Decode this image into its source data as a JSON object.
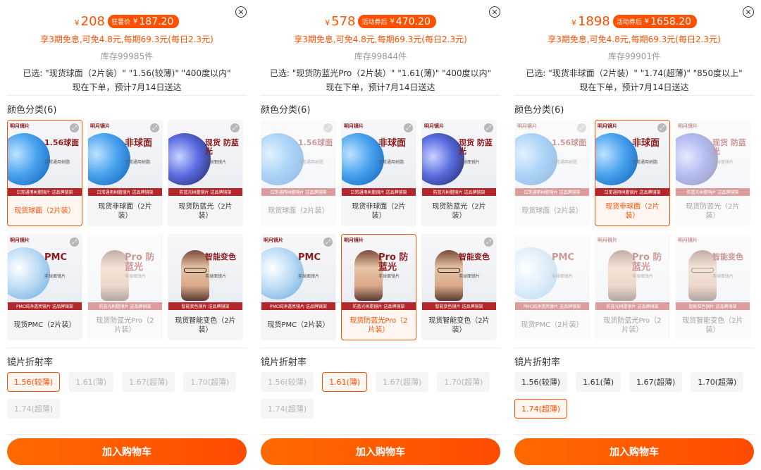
{
  "colors": {
    "accent": "#ff5000",
    "band": "#b3282d"
  },
  "icons": {
    "close": "close-icon",
    "zoom": "expand-icon"
  },
  "lens_options": [
    {
      "thumb_name": "1.56球面",
      "thumb_sub": "日常通用树脂",
      "band": "日常通用树脂镜片 送品牌镜架",
      "style": "blue"
    },
    {
      "thumb_name": "非球面",
      "thumb_sub": "日常通用树脂",
      "band": "日常通用树脂镜片 送品牌镜架",
      "style": "blue"
    },
    {
      "thumb_name": "现货 防蓝光",
      "thumb_sub": "非球面镜片",
      "band": "防蓝光树脂镜片 送品牌镜架",
      "style": "dark"
    },
    {
      "thumb_name": "PMC",
      "thumb_sub": "非球面镜片",
      "band": "PMC纯净透亮镜片 送品牌镜架",
      "style": "light"
    },
    {
      "thumb_name": "Pro 防蓝光",
      "thumb_sub": "非球面镜片",
      "band": "防蓝光树脂镜片 送品牌镜架",
      "style": "face"
    },
    {
      "thumb_name": "智能变色",
      "thumb_sub": "非球面镜片",
      "band": "智能变色镜片 送品牌镜架",
      "style": "face"
    }
  ],
  "panels": [
    {
      "price": "208",
      "promo_tag": "狂暑价",
      "promo_price": "187.20",
      "installment": "享3期免息,可免4.8元,每期69.3元(每日2.3元)",
      "stock": "库存99985件",
      "selected": "已选: \"现货球面（2片装）\" \"1.56(较薄)\" \"400度以内\"",
      "delivery": "现在下单，预计7月14日送达",
      "color_title": "颜色分类(6)",
      "color_options": [
        "现货球面（2片装）",
        "现货非球面（2片装）",
        "现货防蓝光（2片装）",
        "现货PMC（2片装）",
        "现货防蓝光Pro（2片装）",
        "现货智能变色（2片装）"
      ],
      "refractive_title": "镜片折射率",
      "refractive_options": [
        "1.56(较薄)",
        "1.61(薄)",
        "1.67(超薄)",
        "1.70(超薄)",
        "1.74(超薄)"
      ],
      "cart": "加入购物车"
    },
    {
      "price": "578",
      "promo_tag": "活动券后",
      "promo_price": "470.20",
      "installment": "享3期免息,可免4.8元,每期69.3元(每日2.3元)",
      "stock": "库存99844件",
      "selected": "已选: \"现货防蓝光Pro（2片装）\" \"1.61(薄)\" \"400度以内\"",
      "delivery": "现在下单，预计7月14日送达",
      "color_title": "颜色分类(6)",
      "color_options": [
        "现货球面（2片装）",
        "现货非球面（2片装）",
        "现货防蓝光（2片装）",
        "现货PMC（2片装）",
        "现货防蓝光Pro（2片装）",
        "现货智能变色（2片装）"
      ],
      "refractive_title": "镜片折射率",
      "refractive_options": [
        "1.56(较薄)",
        "1.61(薄)",
        "1.67(超薄)",
        "1.70(超薄)",
        "1.74(超薄)"
      ],
      "cart": "加入购物车"
    },
    {
      "price": "1898",
      "promo_tag": "活动券后",
      "promo_price": "1658.20",
      "installment": "享3期免息,可免4.8元,每期69.3元(每日2.3元)",
      "stock": "库存99901件",
      "selected": "已选: \"现货非球面（2片装）\" \"1.74(超薄)\" \"850度以上\"",
      "delivery": "现在下单，预计7月14日送达",
      "color_title": "颜色分类(6)",
      "color_options": [
        "现货球面（2片装）",
        "现货非球面（2片装）",
        "现货防蓝光（2片装）",
        "现货PMC（2片装）",
        "现货防蓝光Pro（2片装）",
        "现货智能变色（2片装）"
      ],
      "refractive_title": "镜片折射率",
      "refractive_options": [
        "1.56(较薄)",
        "1.61(薄)",
        "1.67(超薄)",
        "1.70(超薄)",
        "1.74(超薄)"
      ],
      "cart": "加入购物车"
    }
  ]
}
